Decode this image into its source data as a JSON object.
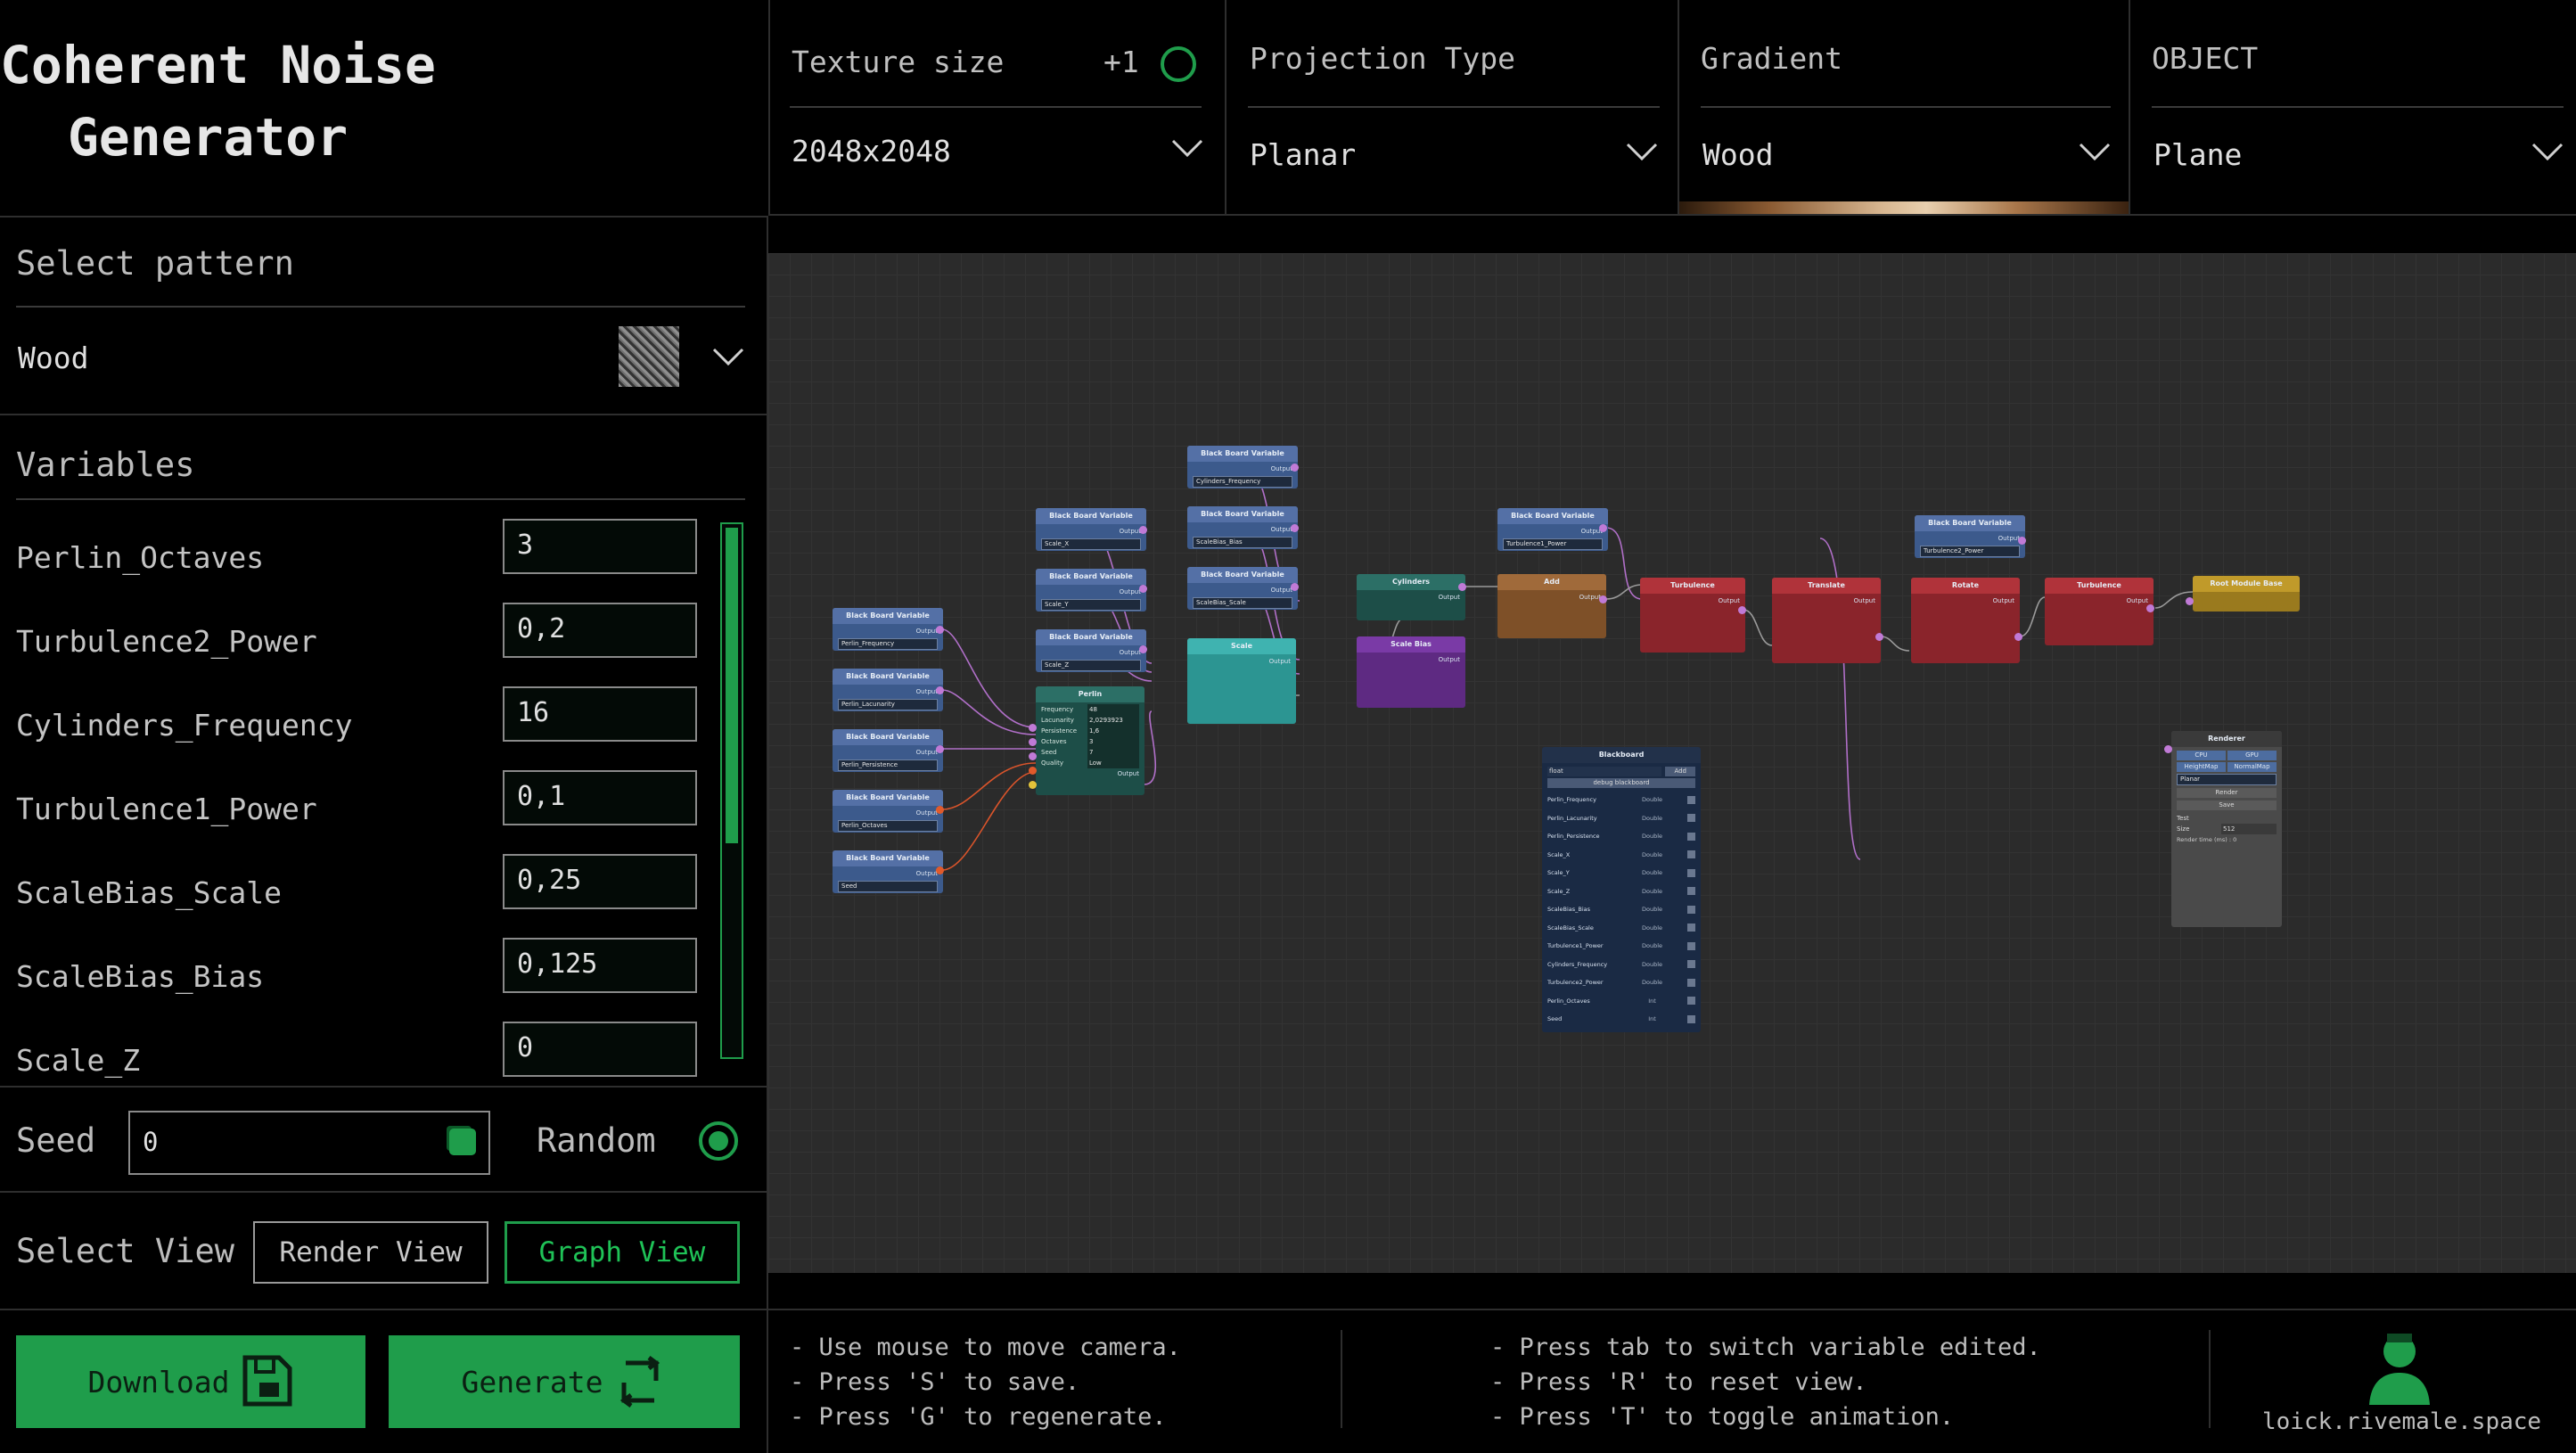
{
  "app": {
    "title_line1": "Coherent Noise",
    "title_line2": "Generator"
  },
  "topbar": {
    "texture": {
      "label": "Texture size",
      "increment": "+1",
      "value": "2048x2048"
    },
    "projection": {
      "label": "Projection Type",
      "value": "Planar"
    },
    "gradient": {
      "label": "Gradient",
      "value": "Wood"
    },
    "object": {
      "label": "OBJECT",
      "value": "Plane"
    }
  },
  "pattern": {
    "label": "Select pattern",
    "value": "Wood"
  },
  "variables": {
    "label": "Variables",
    "items": [
      {
        "name": "Perlin_Octaves",
        "value": "3"
      },
      {
        "name": "Turbulence2_Power",
        "value": "0,2"
      },
      {
        "name": "Cylinders_Frequency",
        "value": "16"
      },
      {
        "name": "Turbulence1_Power",
        "value": "0,1"
      },
      {
        "name": "ScaleBias_Scale",
        "value": "0,25"
      },
      {
        "name": "ScaleBias_Bias",
        "value": "0,125"
      },
      {
        "name": "Scale_Z",
        "value": "0"
      }
    ]
  },
  "seed": {
    "label": "Seed",
    "value": "0",
    "random_label": "Random"
  },
  "view": {
    "label": "Select View",
    "render": "Render View",
    "graph": "Graph View"
  },
  "actions": {
    "download": "Download",
    "generate": "Generate"
  },
  "hints": {
    "left": [
      "- Use mouse to move camera.",
      "- Press 'S' to save.",
      "- Press 'G' to regenerate."
    ],
    "right": [
      "- Press tab to switch variable edited.",
      "- Press 'R' to reset view.",
      "- Press 'T' to toggle animation."
    ]
  },
  "credit": "loick.rivemale.space",
  "colors": {
    "accent_green": "#1f9d4b",
    "background": "#000000",
    "graph_bg": "#2b2b2b"
  },
  "graph": {
    "blackboard_vars": [
      "Perlin_Frequency",
      "Perlin_Lacunarity",
      "Perlin_Persistence",
      "Perlin_Octaves",
      "Seed"
    ],
    "scale_vars": [
      "Scale_X",
      "Scale_Y",
      "Scale_Z"
    ],
    "top_vars": [
      "Cylinders_Frequency",
      "ScaleBias_Bias",
      "ScaleBias_Scale"
    ],
    "turb1_var": "Turbulence1_Power",
    "turb2_var": "Turbulence2_Power",
    "node_bb": "Black Board Variable",
    "node_perlin": "Perlin",
    "node_scale": "Scale",
    "node_cylinders": "Cylinders",
    "node_scalebias": "Scale Bias",
    "node_add": "Add",
    "node_turbulence": "Turbulence",
    "node_translate": "Translate",
    "node_rotate": "Rotate",
    "node_root": "Root Module Base",
    "node_renderer": "Renderer",
    "output": "Output",
    "perlin_rows": [
      {
        "label": "Frequency",
        "value": "48"
      },
      {
        "label": "Lacunarity",
        "value": "2,0293923"
      },
      {
        "label": "Persistence",
        "value": "1,6"
      },
      {
        "label": "Octaves",
        "value": "3"
      },
      {
        "label": "Seed",
        "value": "7"
      },
      {
        "label": "Quality",
        "value": "Low"
      }
    ],
    "blackboard": {
      "title": "Blackboard",
      "type": "float",
      "add": "Add",
      "debug": "debug blackboard",
      "rows": [
        {
          "name": "Perlin_Frequency",
          "type": "Double"
        },
        {
          "name": "Perlin_Lacunarity",
          "type": "Double"
        },
        {
          "name": "Perlin_Persistence",
          "type": "Double"
        },
        {
          "name": "Scale_X",
          "type": "Double"
        },
        {
          "name": "Scale_Y",
          "type": "Double"
        },
        {
          "name": "Scale_Z",
          "type": "Double"
        },
        {
          "name": "ScaleBias_Bias",
          "type": "Double"
        },
        {
          "name": "ScaleBias_Scale",
          "type": "Double"
        },
        {
          "name": "Turbulence1_Power",
          "type": "Double"
        },
        {
          "name": "Cylinders_Frequency",
          "type": "Double"
        },
        {
          "name": "Turbulence2_Power",
          "type": "Double"
        },
        {
          "name": "Perlin_Octaves",
          "type": "Int"
        },
        {
          "name": "Seed",
          "type": "Int"
        }
      ]
    },
    "renderer": {
      "cpu": "CPU",
      "gpu": "GPU",
      "heightmap": "HeightMap",
      "normalmap": "NormalMap",
      "proj": "Planar",
      "render": "Render",
      "save": "Save",
      "test": "Test",
      "size_label": "Size",
      "size": "512",
      "time": "Render time (ms) : 0"
    }
  }
}
